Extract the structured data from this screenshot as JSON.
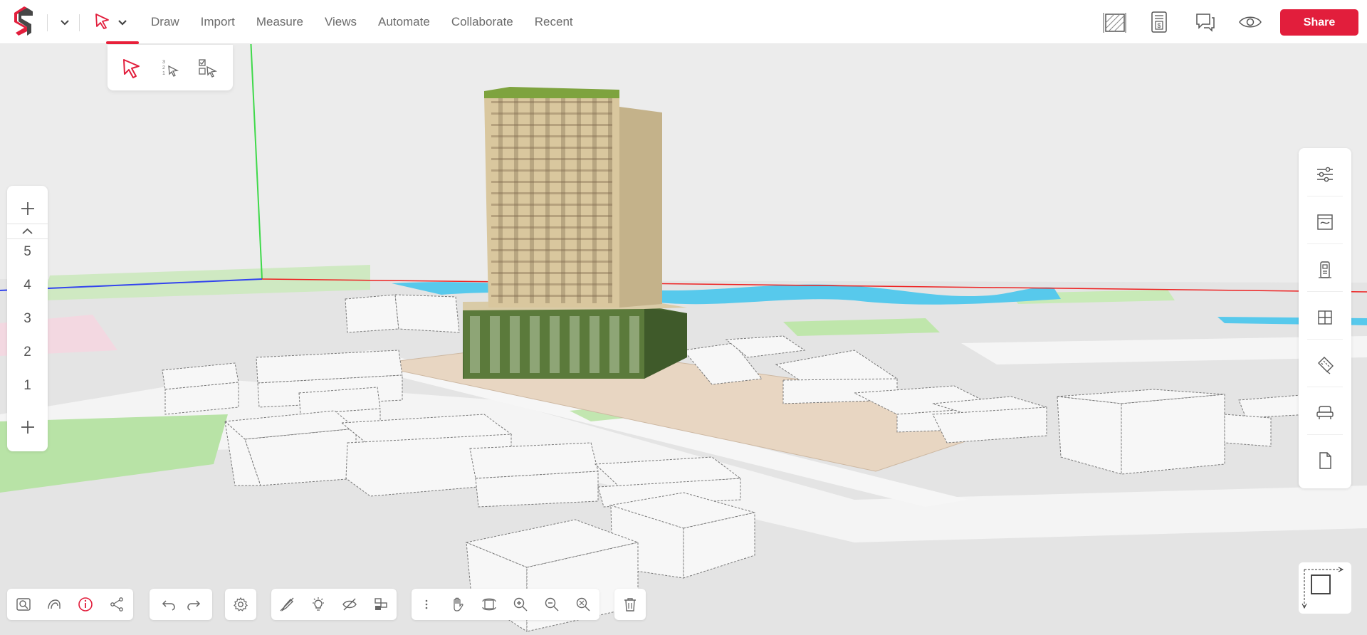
{
  "menu": {
    "items": [
      "Draw",
      "Import",
      "Measure",
      "Views",
      "Automate",
      "Collaborate",
      "Recent"
    ]
  },
  "toolbar_right": {
    "icons": [
      "area-estimate-icon",
      "cost-sheet-icon",
      "comments-icon",
      "visibility-icon"
    ],
    "share_label": "Share"
  },
  "selection_flyout": {
    "icons": [
      "select-arrow-icon",
      "sequential-select-icon",
      "multi-select-icon"
    ]
  },
  "levels": {
    "items": [
      "5",
      "4",
      "3",
      "2",
      "1"
    ]
  },
  "right_panel": {
    "icons": [
      "settings-sliders-icon",
      "materials-icon",
      "building-icon",
      "grid-icon",
      "tape-measure-icon",
      "furniture-icon",
      "document-icon"
    ]
  },
  "bottom_toolbar": {
    "group1": [
      "zoom-fit-icon",
      "sun-study-icon",
      "info-icon",
      "share-graph-icon"
    ],
    "group2": [
      "undo-icon",
      "redo-icon"
    ],
    "group3": [
      "settings-gear-icon"
    ],
    "group4": [
      "hide-pen-icon",
      "light-bulb-icon",
      "isolate-icon",
      "layers-icon"
    ],
    "group5": [
      "more-vertical-icon",
      "pan-hand-icon",
      "orbit-icon",
      "zoom-in-icon",
      "zoom-out-icon",
      "zoom-window-icon"
    ],
    "group6": [
      "delete-icon"
    ]
  },
  "colors": {
    "accent": "#e21e3c",
    "water": "#57c9ec",
    "grass": "#b6e2a4",
    "site": "#e7d5c2"
  }
}
